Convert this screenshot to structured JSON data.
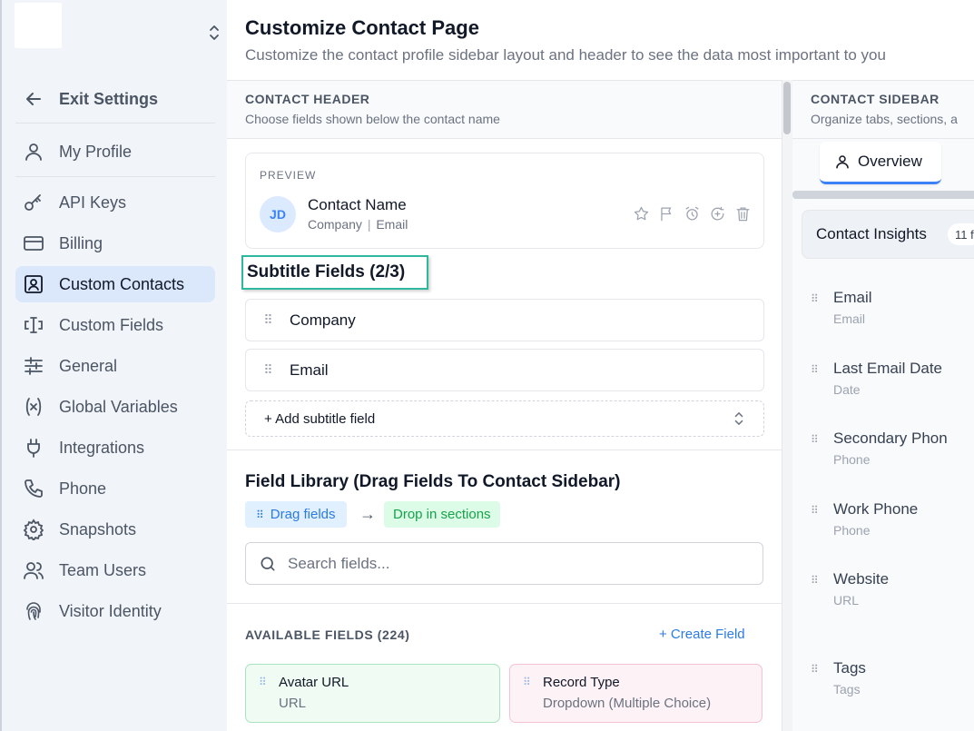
{
  "sidebar": {
    "exit_label": "Exit Settings",
    "items": [
      {
        "label": "My Profile",
        "icon": "user-icon"
      },
      {
        "label": "API Keys",
        "icon": "key-icon"
      },
      {
        "label": "Billing",
        "icon": "credit-card-icon"
      },
      {
        "label": "Custom Contacts",
        "icon": "contact-card-icon",
        "active": true
      },
      {
        "label": "Custom Fields",
        "icon": "text-cursor-icon"
      },
      {
        "label": "General",
        "icon": "sliders-icon"
      },
      {
        "label": "Global Variables",
        "icon": "variable-icon"
      },
      {
        "label": "Integrations",
        "icon": "plug-icon"
      },
      {
        "label": "Phone",
        "icon": "phone-icon"
      },
      {
        "label": "Snapshots",
        "icon": "gear-icon"
      },
      {
        "label": "Team Users",
        "icon": "users-icon"
      },
      {
        "label": "Visitor Identity",
        "icon": "fingerprint-icon"
      }
    ]
  },
  "header": {
    "title": "Customize Contact Page",
    "subtitle": "Customize the contact profile sidebar layout and header to see the data most important to you"
  },
  "contact_header": {
    "label": "CONTACT HEADER",
    "sub": "Choose fields shown below the contact name",
    "preview": {
      "label": "PREVIEW",
      "initials": "JD",
      "name": "Contact Name",
      "sub_company": "Company",
      "sub_separator": "|",
      "sub_email": "Email"
    },
    "subtitle_title": "Subtitle Fields (2/3)",
    "subtitle_fields": [
      "Company",
      "Email"
    ],
    "add_label": "+ Add subtitle field"
  },
  "library": {
    "title": "Field Library (Drag Fields To Contact Sidebar)",
    "drag_chip": "Drag fields",
    "arrow": "→",
    "drop_chip": "Drop in sections",
    "search_placeholder": "Search fields...",
    "available_label": "AVAILABLE FIELDS (224)",
    "create_label": "+ Create Field",
    "cards": [
      {
        "title": "Avatar URL",
        "type": "URL"
      },
      {
        "title": "Record Type",
        "type": "Dropdown (Multiple Choice)"
      }
    ]
  },
  "contact_sidebar": {
    "label": "CONTACT SIDEBAR",
    "sub": "Organize tabs, sections, a",
    "tab_label": "Overview",
    "section_title": "Contact Insights",
    "section_badge": "11 f",
    "fields": [
      {
        "name": "Email",
        "type": "Email"
      },
      {
        "name": "Last Email Date",
        "type": "Date"
      },
      {
        "name": "Secondary Phon",
        "type": "Phone"
      },
      {
        "name": "Work Phone",
        "type": "Phone"
      },
      {
        "name": "Website",
        "type": "URL"
      },
      {
        "name": "Tags",
        "type": "Tags"
      }
    ]
  },
  "colors": {
    "accent": "#3b82f6",
    "active_nav": "#dbe7fb",
    "highlight_border": "#2eb8a0"
  }
}
